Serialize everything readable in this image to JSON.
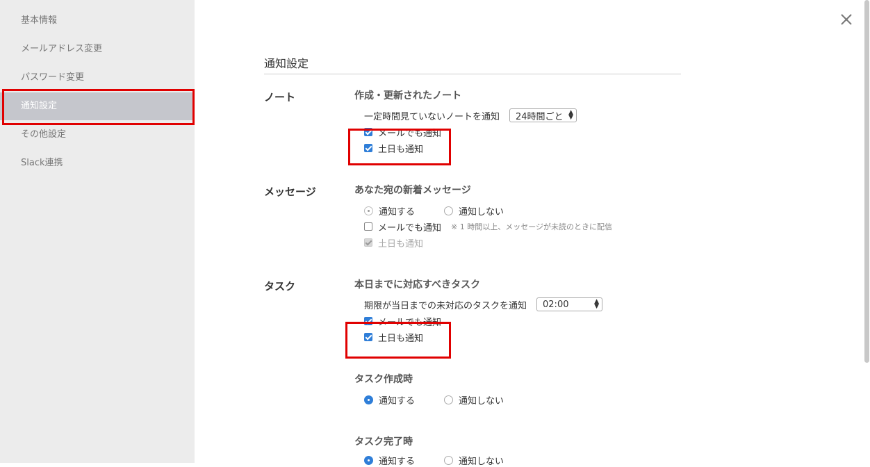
{
  "sidebar": {
    "items": [
      {
        "label": "基本情報"
      },
      {
        "label": "メールアドレス変更"
      },
      {
        "label": "パスワード変更"
      },
      {
        "label": "通知設定"
      },
      {
        "label": "その他設定"
      },
      {
        "label": "Slack連携"
      }
    ]
  },
  "main": {
    "title": "通知設定",
    "note_section": {
      "label": "ノート",
      "subhead": "作成・更新されたノート",
      "notify_label": "一定時間見ていないノートを通知",
      "notify_select_value": "24時間ごと",
      "email_label": "メールでも通知",
      "email_checked": true,
      "weekend_label": "土日も通知",
      "weekend_checked": true
    },
    "message_section": {
      "label": "メッセージ",
      "subhead": "あなた宛の新着メッセージ",
      "radio_notify": "通知する",
      "radio_no_notify": "通知しない",
      "email_label": "メールでも通知",
      "email_checked": false,
      "email_note": "※ 1 時間以上、メッセージが未読のときに配信",
      "weekend_label": "土日も通知",
      "weekend_checked": true
    },
    "task_section": {
      "label": "タスク",
      "subhead": "本日までに対応すべきタスク",
      "notify_label": "期限が当日までの未対応のタスクを通知",
      "notify_select_value": "02:00",
      "email_label": "メールでも通知",
      "email_checked": true,
      "weekend_label": "土日も通知",
      "weekend_checked": true,
      "created_subhead": "タスク作成時",
      "created_radio_notify": "通知する",
      "created_radio_no_notify": "通知しない",
      "completed_subhead": "タスク完了時",
      "completed_radio_notify": "通知する",
      "completed_radio_no_notify": "通知しない"
    }
  },
  "colors": {
    "sidebar_bg": "#ececec",
    "active_item_bg": "#c5c6cc",
    "accent": "#2f7ed8",
    "highlight": "#e00000"
  },
  "icons": {
    "close": "close-icon",
    "select_arrows": "updown-arrows-icon"
  }
}
